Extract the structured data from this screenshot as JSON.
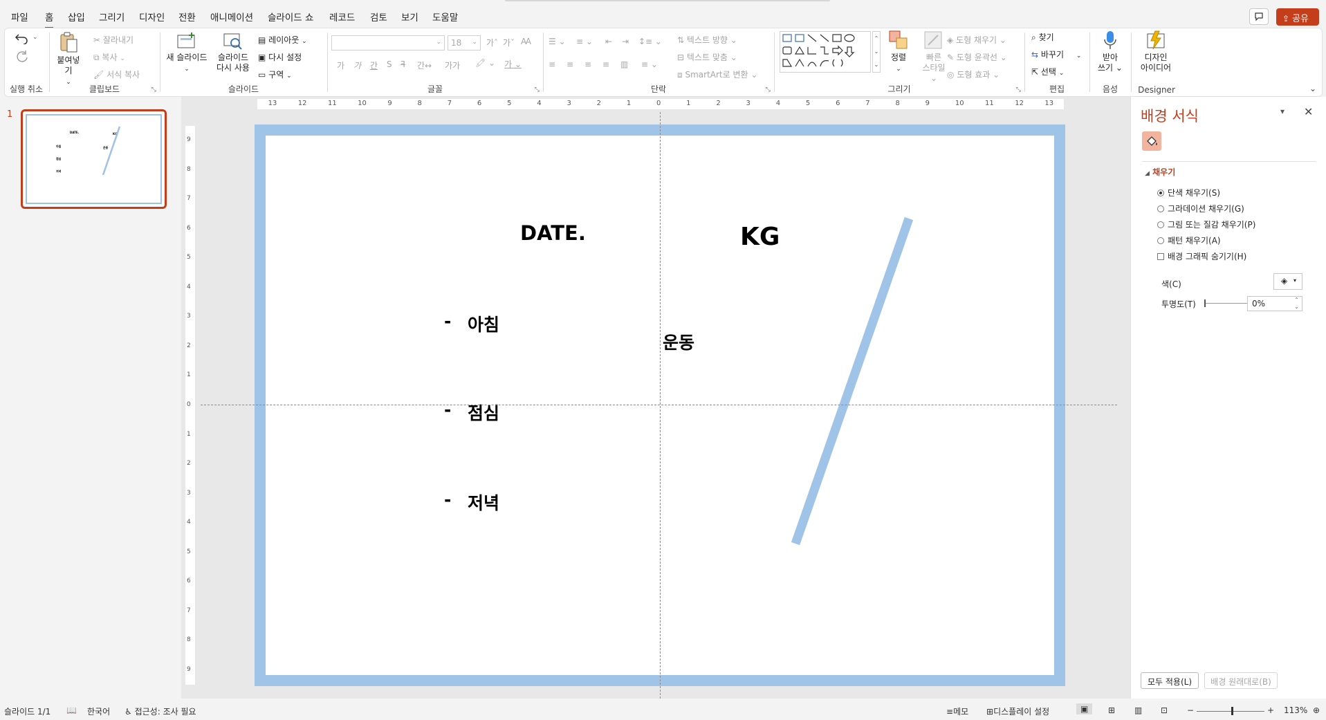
{
  "menu": {
    "tabs": [
      "파일",
      "홈",
      "삽입",
      "그리기",
      "디자인",
      "전환",
      "애니메이션",
      "슬라이드 쇼",
      "레코드",
      "검토",
      "보기",
      "도움말"
    ],
    "active": "홈",
    "share": "공유"
  },
  "ribbon": {
    "undo": {
      "label": "실행 취소"
    },
    "clipboard": {
      "label": "클립보드",
      "paste": "붙여넣기",
      "cut": "잘라내기",
      "copy": "복사",
      "format_painter": "서식 복사"
    },
    "slides": {
      "label": "슬라이드",
      "new_slide": "새 슬라이드",
      "reuse_line1": "슬라이드",
      "reuse_line2": "다시 사용",
      "layout": "레이아웃",
      "reset": "다시 설정",
      "section": "구역"
    },
    "font": {
      "label": "글꼴",
      "font_name": "",
      "font_size": "18"
    },
    "paragraph": {
      "label": "단락",
      "text_direction": "텍스트 방향",
      "align_text": "텍스트 맞춤",
      "smartart": "SmartArt로 변환"
    },
    "drawing": {
      "label": "그리기",
      "arrange": "정렬",
      "quick_styles_line1": "빠른",
      "quick_styles_line2": "스타일",
      "shape_fill": "도형 채우기",
      "shape_outline": "도형 윤곽선",
      "shape_effects": "도형 효과"
    },
    "editing": {
      "label": "편집",
      "find": "찾기",
      "replace": "바꾸기",
      "select": "선택"
    },
    "voice": {
      "label": "음성",
      "dictate_line1": "받아",
      "dictate_line2": "쓰기"
    },
    "designer": {
      "label": "Designer",
      "ideas_line1": "디자인",
      "ideas_line2": "아이디어"
    }
  },
  "thumbnail": {
    "number": "1"
  },
  "slide": {
    "date": "DATE.",
    "kg": "KG",
    "exercise": "운동",
    "dash": "-",
    "breakfast": "아침",
    "lunch": "점심",
    "dinner": "저녁",
    "frame_color": "#a0c4e7",
    "line_color": "#a0c4e7"
  },
  "ruler": {
    "h_ticks": [
      "13",
      "12",
      "11",
      "10",
      "9",
      "8",
      "7",
      "6",
      "5",
      "4",
      "3",
      "2",
      "1",
      "0",
      "1",
      "2",
      "3",
      "4",
      "5",
      "6",
      "7",
      "8",
      "9",
      "10",
      "11",
      "12",
      "13"
    ],
    "v_ticks": [
      "9",
      "8",
      "7",
      "6",
      "5",
      "4",
      "3",
      "2",
      "1",
      "0",
      "1",
      "2",
      "3",
      "4",
      "5",
      "6",
      "7",
      "8",
      "9"
    ]
  },
  "format_pane": {
    "title": "배경 서식",
    "section": "채우기",
    "solid_fill": "단색 채우기(S)",
    "gradient_fill": "그라데이션 채우기(G)",
    "picture_fill": "그림 또는 질감 채우기(P)",
    "pattern_fill": "패턴 채우기(A)",
    "hide_graphics": "배경 그래픽 숨기기(H)",
    "color_label": "색(C)",
    "transparency_label": "투명도(T)",
    "transparency_value": "0%",
    "apply_all": "모두 적용(L)",
    "reset_background": "배경 원래대로(B)"
  },
  "status": {
    "slide_count": "슬라이드 1/1",
    "language": "한국어",
    "accessibility": "접근성: 조사 필요",
    "notes": "메모",
    "display_settings": "디스플레이 설정",
    "zoom": "113%"
  },
  "colors": {
    "accent": "#c43e1c"
  }
}
